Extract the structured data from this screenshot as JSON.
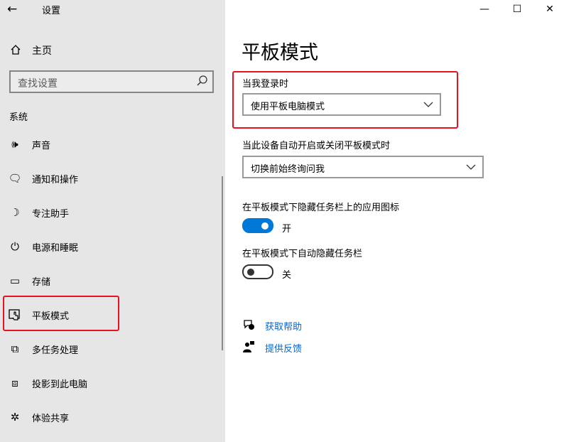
{
  "window": {
    "app_title": "设置",
    "back_glyph": "←",
    "minimize_glyph": "—",
    "maximize_glyph": "☐",
    "close_glyph": "✕"
  },
  "sidebar": {
    "home_label": "主页",
    "search_placeholder": "查找设置",
    "section_title": "系统",
    "items": [
      {
        "label": "声音",
        "icon": "speaker-icon",
        "glyph": "🕪"
      },
      {
        "label": "通知和操作",
        "icon": "notification-icon",
        "glyph": "🗨"
      },
      {
        "label": "专注助手",
        "icon": "moon-icon",
        "glyph": "☽"
      },
      {
        "label": "电源和睡眠",
        "icon": "power-icon",
        "glyph": "⏻"
      },
      {
        "label": "存储",
        "icon": "storage-icon",
        "glyph": "▭"
      },
      {
        "label": "平板模式",
        "icon": "tablet-mode-icon",
        "glyph": "☐"
      },
      {
        "label": "多任务处理",
        "icon": "multitask-icon",
        "glyph": "⧉"
      },
      {
        "label": "投影到此电脑",
        "icon": "project-icon",
        "glyph": "⧈"
      },
      {
        "label": "体验共享",
        "icon": "share-icon",
        "glyph": "✲"
      }
    ]
  },
  "main": {
    "title": "平板模式",
    "signin_label": "当我登录时",
    "signin_value": "使用平板电脑模式",
    "auto_label": "当此设备自动开启或关闭平板模式时",
    "auto_value": "切换前始终询问我",
    "hide_icons_label": "在平板模式下隐藏任务栏上的应用图标",
    "hide_icons_state": "开",
    "hide_icons_on": true,
    "auto_hide_label": "在平板模式下自动隐藏任务栏",
    "auto_hide_state": "关",
    "auto_hide_on": false,
    "help_link": "获取帮助",
    "feedback_link": "提供反馈"
  },
  "colors": {
    "accent": "#0078d7",
    "highlight": "#e81123",
    "link": "#0a64c8",
    "sidebar_bg": "#e6e6e6"
  }
}
